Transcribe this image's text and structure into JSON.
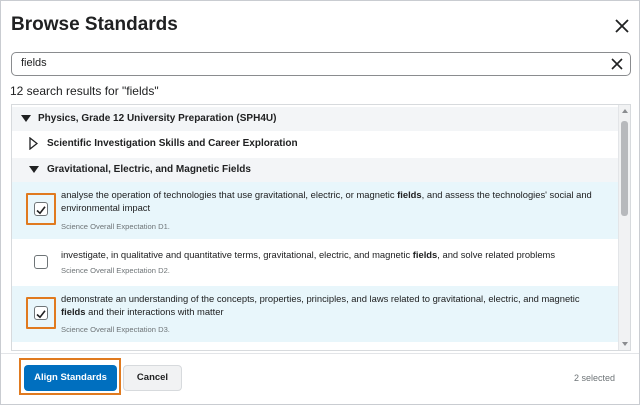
{
  "dialog": {
    "title": "Browse Standards"
  },
  "search": {
    "value": "fields"
  },
  "results": {
    "count_text": "12 search results for \"fields\""
  },
  "tree": {
    "course": "Physics, Grade 12 University Preparation (SPH4U)",
    "strand_a": "Scientific Investigation Skills and Career Exploration",
    "strand_b": "Gravitational, Electric, and Magnetic Fields"
  },
  "items": [
    {
      "checked": true,
      "text_before": "analyse the operation of technologies that use gravitational, electric, or magnetic ",
      "highlight": "fields",
      "text_after": ", and assess the technologies' social and environmental impact",
      "sub": "Science Overall Expectation D1."
    },
    {
      "checked": false,
      "text_before": "investigate, in qualitative and quantitative terms, gravitational, electric, and magnetic ",
      "highlight": "fields",
      "text_after": ", and solve related problems",
      "sub": "Science Overall Expectation D2."
    },
    {
      "checked": true,
      "text_before": "demonstrate an understanding of the concepts, properties, principles, and laws related to gravitational, electric, and magnetic ",
      "highlight": "fields",
      "text_after": " and their interactions with matter",
      "sub": "Science Overall Expectation D3."
    }
  ],
  "footer": {
    "align_label": "Align Standards",
    "cancel_label": "Cancel",
    "selected_text": "2 selected"
  },
  "colors": {
    "primary": "#006fbf",
    "selected_bg": "#e8f6fb",
    "highlight_box": "#e07a1f"
  }
}
